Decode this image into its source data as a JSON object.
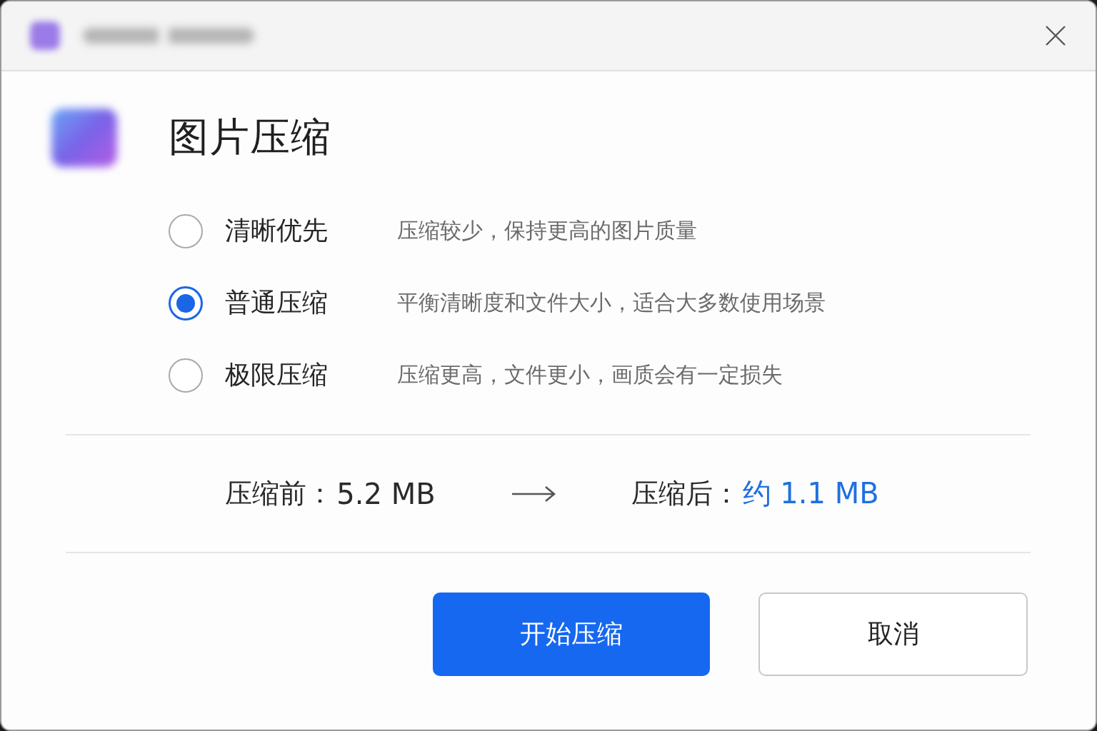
{
  "dialog": {
    "title": "图片压缩"
  },
  "options": [
    {
      "label": "清晰优先",
      "description": "压缩较少，保持更高的图片质量",
      "selected": false
    },
    {
      "label": "普通压缩",
      "description": "平衡清晰度和文件大小，适合大多数使用场景",
      "selected": true
    },
    {
      "label": "极限压缩",
      "description": "压缩更高，文件更小，画质会有一定损失",
      "selected": false
    }
  ],
  "size_comparison": {
    "before_label": "压缩前：",
    "before_value": "5.2 MB",
    "after_label": "压缩后：",
    "after_value": "约 1.1 MB"
  },
  "buttons": [
    {
      "label": "开始压缩",
      "kind": "primary"
    },
    {
      "label": "取消",
      "kind": "secondary"
    }
  ]
}
